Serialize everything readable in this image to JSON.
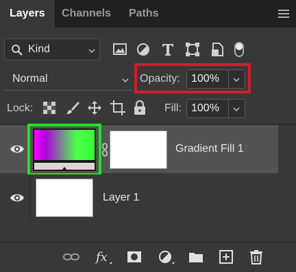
{
  "tabs": [
    {
      "label": "Layers",
      "active": true
    },
    {
      "label": "Channels",
      "active": false
    },
    {
      "label": "Paths",
      "active": false
    }
  ],
  "filter": {
    "kind_label": "Kind",
    "icons": [
      "image-filter-icon",
      "adjustment-filter-icon",
      "type-filter-icon",
      "shape-filter-icon",
      "smart-object-filter-icon",
      "filter-toggle-icon"
    ]
  },
  "blend_mode": {
    "value": "Normal"
  },
  "opacity": {
    "label": "Opacity:",
    "value": "100%"
  },
  "lock": {
    "label": "Lock:",
    "icons": [
      "lock-transparent-pixels-icon",
      "lock-image-pixels-icon",
      "lock-position-icon",
      "lock-artboard-icon",
      "lock-all-icon"
    ]
  },
  "fill": {
    "label": "Fill:",
    "value": "100%"
  },
  "layers": [
    {
      "name": "Gradient Fill 1",
      "visible": true,
      "selected": true,
      "gradient_colors": [
        "#ff00ff",
        "#33ff33"
      ]
    },
    {
      "name": "Layer 1",
      "visible": true,
      "selected": false
    }
  ],
  "bottom_icons": [
    "link-layers-icon",
    "fx-icon",
    "add-mask-icon",
    "new-adjustment-icon",
    "new-group-icon",
    "new-layer-icon",
    "delete-icon"
  ],
  "colors": {
    "highlight_red": "#cc1f2c",
    "highlight_green": "#22e022",
    "selected_row": "#535353"
  }
}
